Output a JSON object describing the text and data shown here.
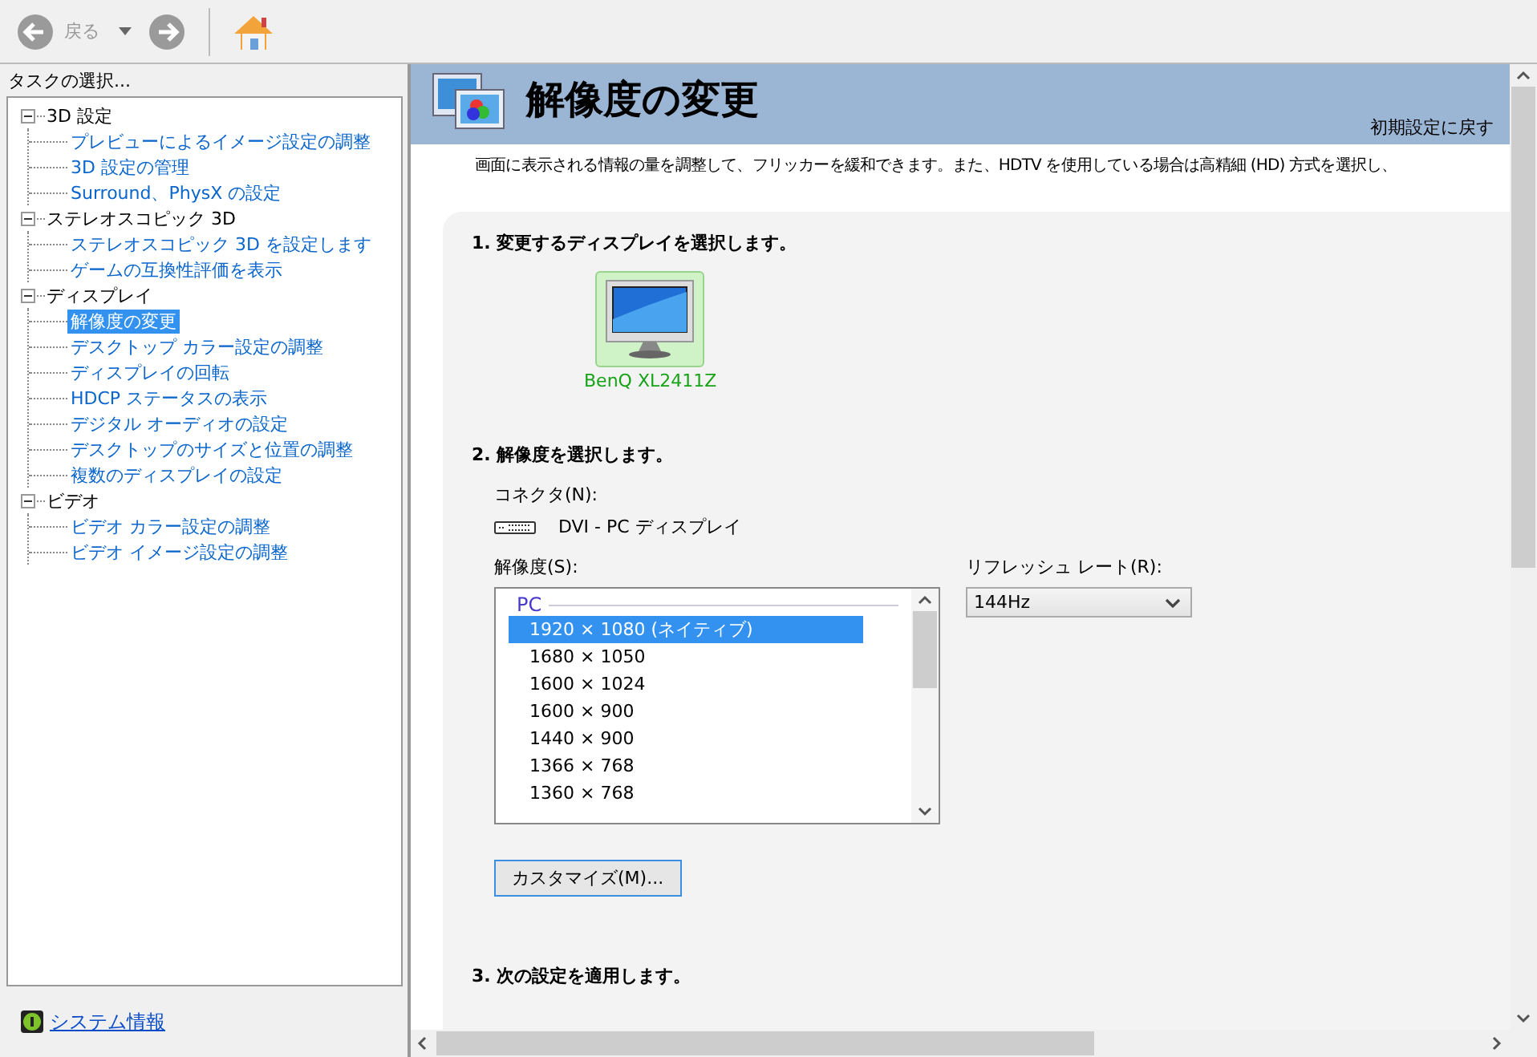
{
  "toolbar": {
    "back_label": "戻る"
  },
  "sidebar": {
    "title": "タスクの選択...",
    "tree": [
      {
        "label": "3D 設定",
        "expanded": true,
        "children": [
          {
            "label": "プレビューによるイメージ設定の調整",
            "selected": false
          },
          {
            "label": "3D 設定の管理",
            "selected": false
          },
          {
            "label": "Surround、PhysX の設定",
            "selected": false
          }
        ]
      },
      {
        "label": "ステレオスコピック 3D",
        "expanded": true,
        "children": [
          {
            "label": "ステレオスコピック 3D を設定します",
            "selected": false
          },
          {
            "label": "ゲームの互換性評価を表示",
            "selected": false
          }
        ]
      },
      {
        "label": "ディスプレイ",
        "expanded": true,
        "children": [
          {
            "label": "解像度の変更",
            "selected": true
          },
          {
            "label": "デスクトップ カラー設定の調整",
            "selected": false
          },
          {
            "label": "ディスプレイの回転",
            "selected": false
          },
          {
            "label": "HDCP ステータスの表示",
            "selected": false
          },
          {
            "label": "デジタル オーディオの設定",
            "selected": false
          },
          {
            "label": "デスクトップのサイズと位置の調整",
            "selected": false
          },
          {
            "label": "複数のディスプレイの設定",
            "selected": false
          }
        ]
      },
      {
        "label": "ビデオ",
        "expanded": true,
        "children": [
          {
            "label": "ビデオ カラー設定の調整",
            "selected": false
          },
          {
            "label": "ビデオ イメージ設定の調整",
            "selected": false
          }
        ]
      }
    ],
    "system_info_link": "システム情報"
  },
  "page": {
    "title": "解像度の変更",
    "restore_link": "初期設定に戻す",
    "description": "画面に表示される情報の量を調整して、フリッカーを緩和できます。また、HDTV を使用している場合は高精細 (HD) 方式を選択し、",
    "step1": {
      "heading": "1. 変更するディスプレイを選択します。",
      "displays": [
        {
          "name": "BenQ XL2411Z",
          "selected": true
        }
      ]
    },
    "step2": {
      "heading": "2. 解像度を選択します。",
      "connector_label": "コネクタ(N):",
      "connector_value": "DVI - PC ディスプレイ",
      "resolution_label": "解像度(S):",
      "group": "PC",
      "resolutions": [
        {
          "label": "1920 × 1080 (ネイティブ)",
          "selected": true
        },
        {
          "label": "1680 × 1050",
          "selected": false
        },
        {
          "label": "1600 × 1024",
          "selected": false
        },
        {
          "label": "1600 × 900",
          "selected": false
        },
        {
          "label": "1440 × 900",
          "selected": false
        },
        {
          "label": "1366 × 768",
          "selected": false
        },
        {
          "label": "1360 × 768",
          "selected": false
        }
      ],
      "refresh_label": "リフレッシュ レート(R):",
      "refresh_value": "144Hz",
      "customize_button": "カスタマイズ(M)..."
    },
    "step3": {
      "heading": "3. 次の設定を適用します。"
    }
  }
}
